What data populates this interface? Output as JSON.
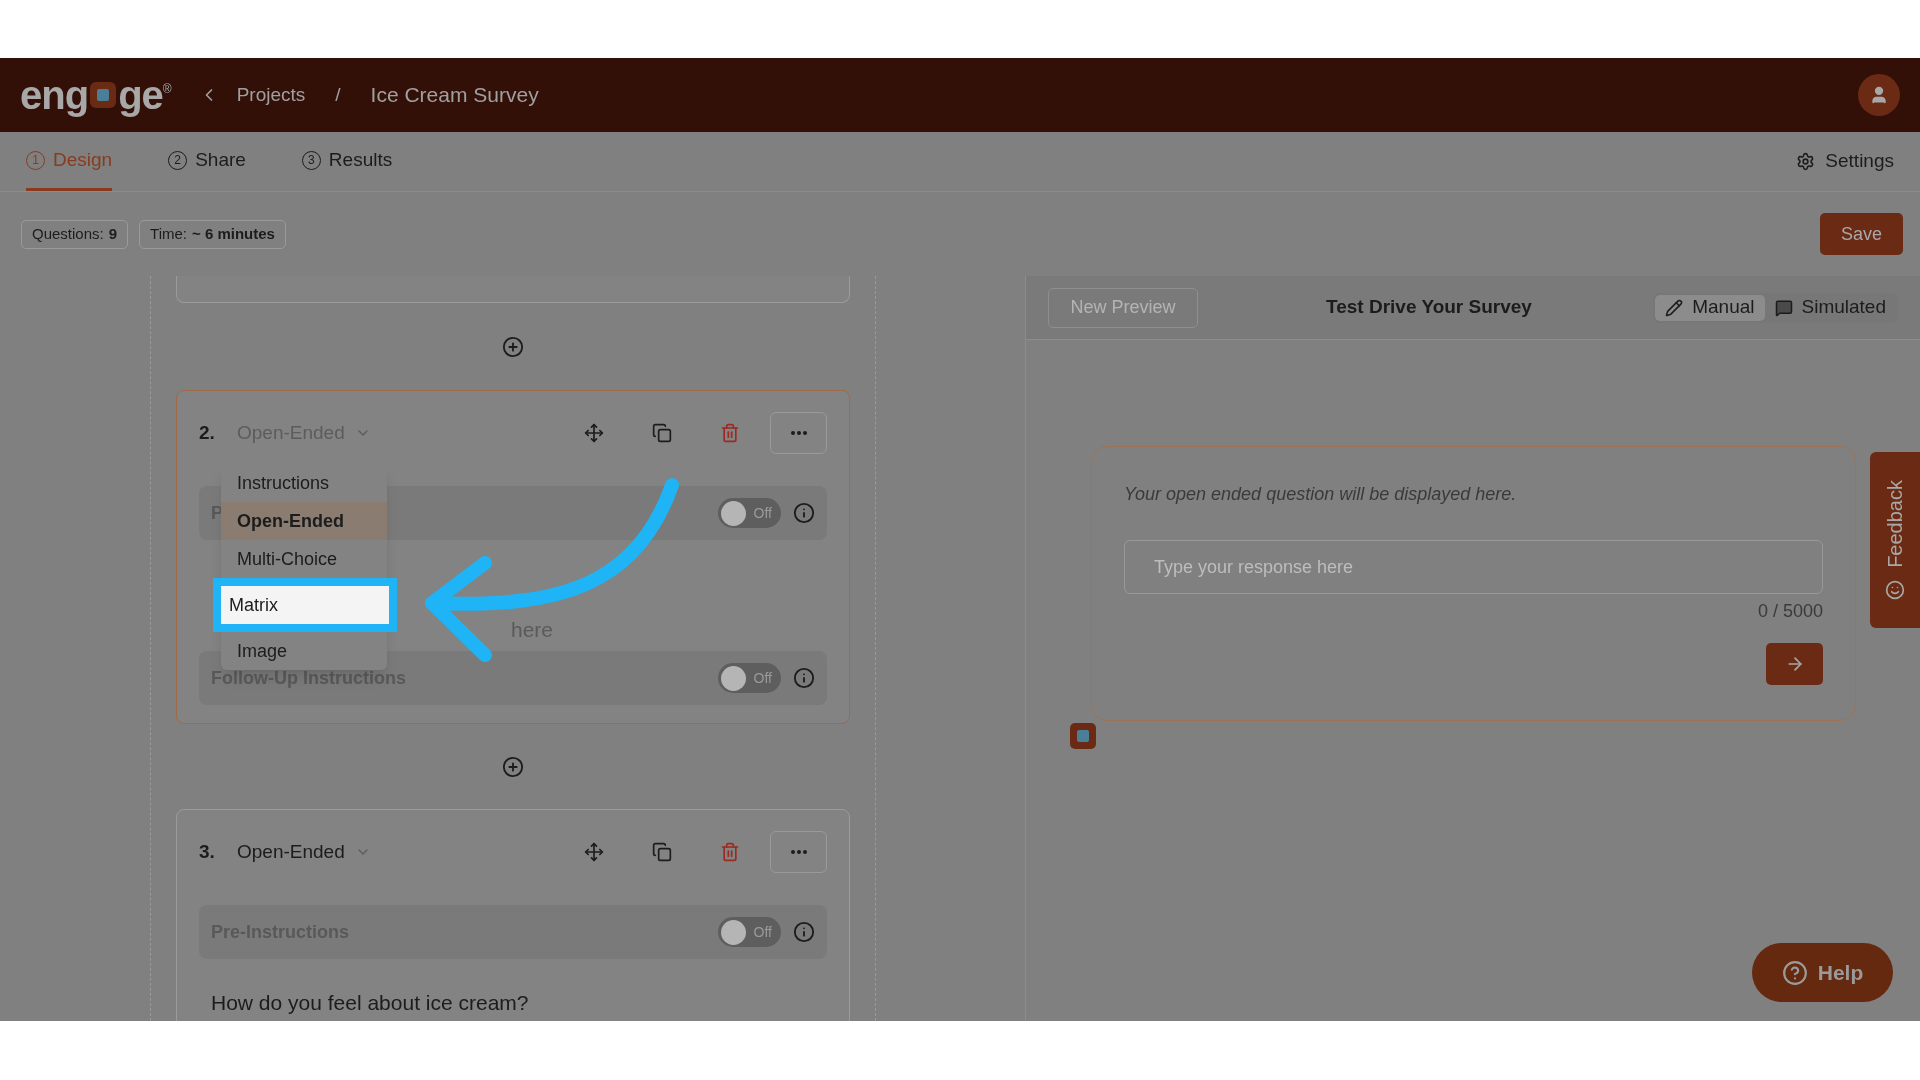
{
  "brand": {
    "logo_parts": [
      "eng",
      "ge"
    ],
    "logo_mark": "®"
  },
  "breadcrumb": {
    "back": "Projects",
    "separator": "/",
    "current": "Ice Cream Survey"
  },
  "tabs": [
    {
      "number": "1",
      "label": "Design",
      "selected": true
    },
    {
      "number": "2",
      "label": "Share",
      "selected": false
    },
    {
      "number": "3",
      "label": "Results",
      "selected": false
    }
  ],
  "settings": "Settings",
  "stats": [
    {
      "label": "Questions:",
      "value": "9"
    },
    {
      "label": "Time:",
      "value": "~ 6 minutes"
    }
  ],
  "save": "Save",
  "questions": [
    {
      "number": "2.",
      "type": "Open-Ended",
      "selected": true,
      "expanded": true,
      "rows": [
        {
          "kind": "toggle",
          "label": "P",
          "on": false,
          "toggle_text": "Off"
        },
        {
          "kind": "fragment",
          "text": "here"
        },
        {
          "kind": "toggle",
          "label": "Follow-Up Instructions",
          "on": false,
          "toggle_text": "Off"
        }
      ]
    },
    {
      "number": "3.",
      "type": "Open-Ended",
      "selected": false,
      "expanded": false,
      "rows": [
        {
          "kind": "toggle",
          "label": "Pre-Instructions",
          "on": false,
          "toggle_text": "Off"
        },
        {
          "kind": "text",
          "text": "How do you feel about ice cream?"
        }
      ]
    }
  ],
  "type_menu": [
    {
      "label": "Instructions",
      "selected": false,
      "highlighted": false
    },
    {
      "label": "Open-Ended",
      "selected": true,
      "highlighted": false
    },
    {
      "label": "Multi-Choice",
      "selected": false,
      "highlighted": false
    },
    {
      "label": "Matrix",
      "selected": false,
      "highlighted": true
    },
    {
      "label": "Image",
      "selected": false,
      "highlighted": false
    }
  ],
  "preview": {
    "new_preview": "New Preview",
    "title": "Test Drive Your Survey",
    "modes": [
      {
        "label": "Manual",
        "selected": true
      },
      {
        "label": "Simulated",
        "selected": false
      }
    ],
    "question": "Your open ended question will be displayed here.",
    "placeholder": "Type your response here",
    "counter": "0 / 5000"
  },
  "feedback": "Feedback",
  "help": "Help"
}
